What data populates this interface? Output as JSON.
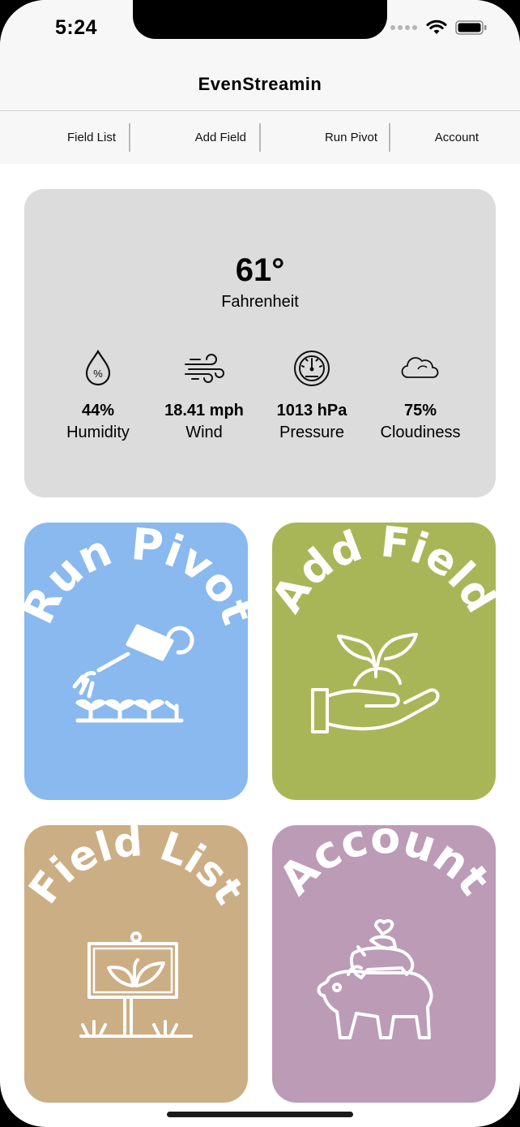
{
  "status_bar": {
    "time": "5:24"
  },
  "app": {
    "title": "EvenStreamin"
  },
  "tabs": [
    {
      "label": "Field List"
    },
    {
      "label": "Add Field"
    },
    {
      "label": "Run Pivot"
    },
    {
      "label": "Account"
    }
  ],
  "weather": {
    "temperature": "61°",
    "unit": "Fahrenheit",
    "metrics": [
      {
        "value": "44%",
        "label": "Humidity",
        "icon": "humidity-drop-icon"
      },
      {
        "value": "18.41 mph",
        "label": "Wind",
        "icon": "wind-icon"
      },
      {
        "value": "1013 hPa",
        "label": "Pressure",
        "icon": "pressure-gauge-icon"
      },
      {
        "value": "75%",
        "label": "Cloudiness",
        "icon": "cloud-icon"
      }
    ]
  },
  "tiles": [
    {
      "label": "Run Pivot",
      "color": "#89b9ee",
      "icon": "watering-can-icon"
    },
    {
      "label": "Add Field",
      "color": "#a9b657",
      "icon": "hand-sprout-icon"
    },
    {
      "label": "Field List",
      "color": "#ccae85",
      "icon": "field-sign-icon"
    },
    {
      "label": "Account",
      "color": "#bb9bb6",
      "icon": "stacked-animals-icon"
    }
  ]
}
